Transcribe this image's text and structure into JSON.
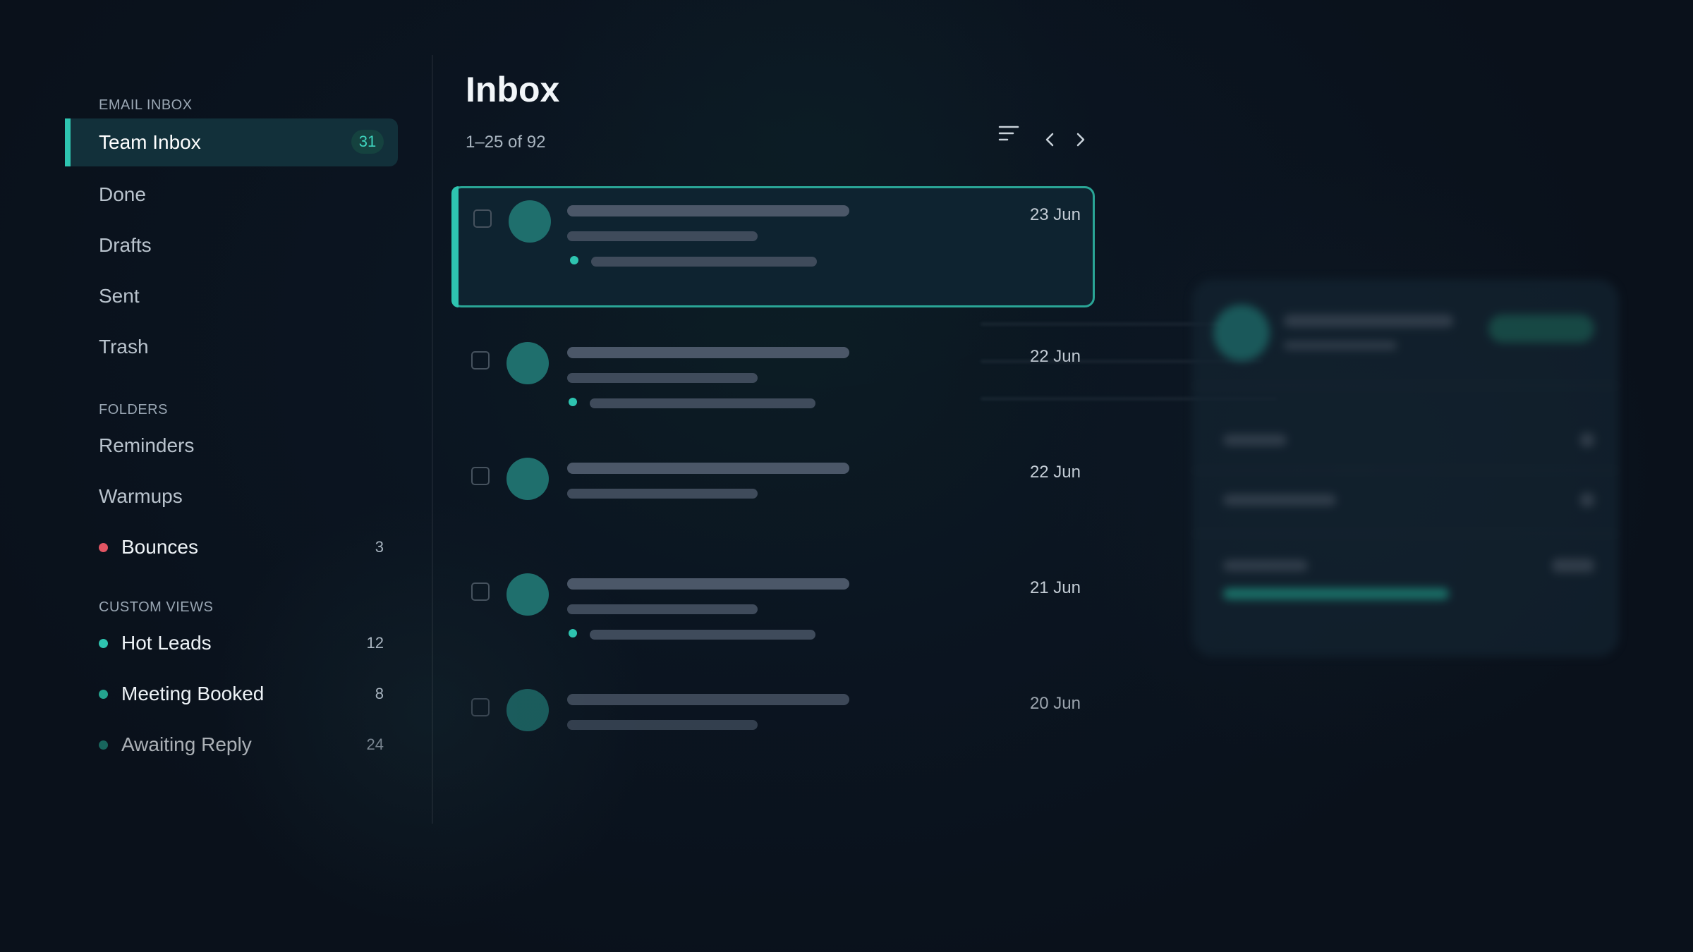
{
  "sidebar": {
    "sections": {
      "email_inbox": "EMAIL INBOX",
      "folders": "FOLDERS",
      "custom_views": "CUSTOM VIEWS"
    },
    "email_items": [
      {
        "label": "Team Inbox",
        "badge": "31",
        "active": true
      },
      {
        "label": "Done"
      },
      {
        "label": "Drafts"
      },
      {
        "label": "Sent"
      },
      {
        "label": "Trash"
      }
    ],
    "folder_items": [
      {
        "label": "Reminders"
      },
      {
        "label": "Warmups"
      },
      {
        "label": "Bounces",
        "count": "3",
        "dot_color": "#e25563"
      }
    ],
    "custom_view_items": [
      {
        "label": "Hot Leads",
        "count": "12",
        "dot_color": "#2ec4b0"
      },
      {
        "label": "Meeting Booked",
        "count": "8",
        "dot_color": "#24a48f"
      },
      {
        "label": "Awaiting Reply",
        "count": "24",
        "dot_color": "#1e8a7a"
      }
    ]
  },
  "main": {
    "title": "Inbox",
    "range_text": "1–25 of 92",
    "icons": {
      "sort": "sort-lines-icon",
      "prev": "chevron-left-icon",
      "next": "chevron-right-icon"
    },
    "messages": [
      {
        "date": "23 Jun",
        "selected": true,
        "has_status": true
      },
      {
        "date": "22 Jun",
        "selected": false,
        "has_status": true
      },
      {
        "date": "22 Jun",
        "selected": false,
        "has_status": false
      },
      {
        "date": "21 Jun",
        "selected": false,
        "has_status": true
      },
      {
        "date": "20 Jun",
        "selected": false,
        "has_status": false
      }
    ]
  },
  "colors": {
    "accent": "#2ec4b0",
    "background": "#0b1521",
    "avatar": "#1f6f6d",
    "danger_dot": "#e25563"
  }
}
